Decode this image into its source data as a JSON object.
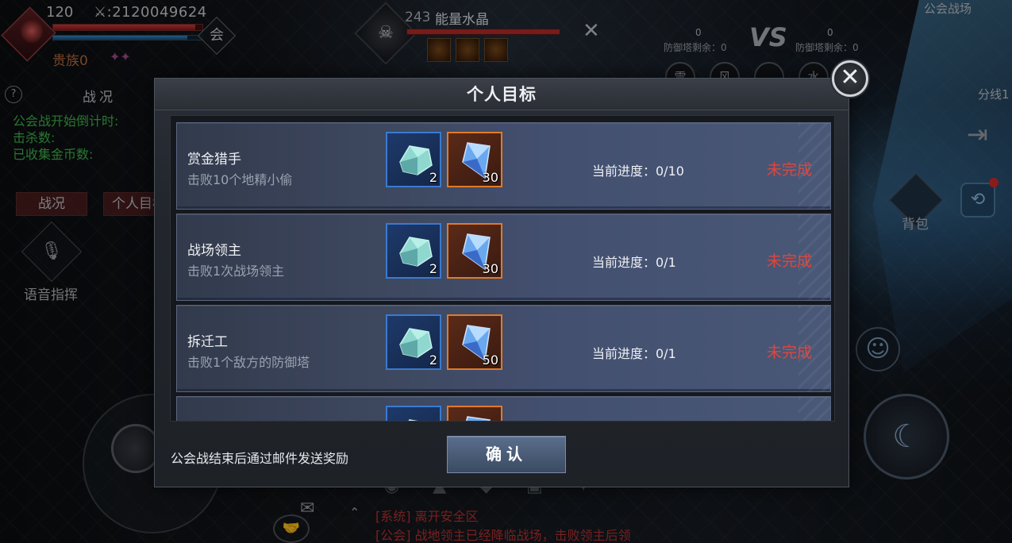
{
  "hud": {
    "level": "120",
    "power": ":2120049624",
    "noble": "贵族0",
    "guild_label": "会",
    "hp_fraction": 0.95,
    "mp_fraction": 0.9
  },
  "boss": {
    "level": "243",
    "name": "能量水晶",
    "hp_fraction": 1.0
  },
  "battle": {
    "title": "公会战场",
    "left_score": "0",
    "left_tower": "防御塔剩余：0",
    "vs": "VS",
    "right_score": "0",
    "right_tower": "防御塔剩余：0",
    "badges": [
      "雷",
      "风",
      "",
      "水"
    ],
    "line_label": "分线1"
  },
  "left_panel": {
    "help": "?",
    "tab_title": "战况",
    "lines": [
      "公会战开始倒计时:",
      "击杀数:",
      "已收集金币数:"
    ],
    "btn_status": "战况",
    "btn_personal": "个人目标",
    "voice_label": "语音指挥"
  },
  "right_panel": {
    "bag_label": "背包"
  },
  "chat": {
    "line1": "[系统] 离开安全区",
    "line2": "[公会] 战地领主已经降临战场，击败领主后领"
  },
  "dialog": {
    "title": "个人目标",
    "close_label": "✕",
    "progress_prefix": "当前进度：",
    "footer_note": "公会战结束后通过邮件发送奖励",
    "confirm_label": "确认",
    "tasks": [
      {
        "name": "赏金猎手",
        "desc": "击败10个地精小偷",
        "reward1": "2",
        "reward2": "30",
        "progress": "当前进度：0/10",
        "status": "未完成"
      },
      {
        "name": "战场领主",
        "desc": "击败1次战场领主",
        "reward1": "2",
        "reward2": "30",
        "progress": "当前进度：0/1",
        "status": "未完成"
      },
      {
        "name": "拆迁工",
        "desc": "击败1个敌方的防御塔",
        "reward1": "2",
        "reward2": "50",
        "progress": "当前进度：0/1",
        "status": "未完成"
      }
    ]
  },
  "colors": {
    "status_incomplete": "#e0463c",
    "reward_blue": "#3a7ad0",
    "reward_orange": "#e07a2a",
    "chat_red": "#b83232",
    "timer_green": "#3fb64a"
  },
  "icons": {
    "close": "close-icon",
    "mic": "microphone-icon",
    "bag": "backpack-icon",
    "exit": "exit-door-icon",
    "emoji": "smiley-icon",
    "skill": "skill-icon",
    "mail": "mail-icon"
  }
}
